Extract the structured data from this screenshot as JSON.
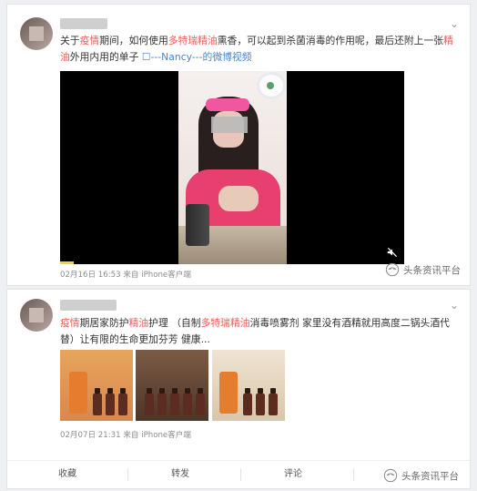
{
  "post1": {
    "text_parts": [
      {
        "t": "关于",
        "hl": false
      },
      {
        "t": "疫情",
        "hl": true
      },
      {
        "t": "期间，如何使用",
        "hl": false
      },
      {
        "t": "多特瑞精油",
        "hl": true
      },
      {
        "t": "熏香，可以起到杀菌消毒的作用呢，最后还附上一张",
        "hl": false
      },
      {
        "t": "精油",
        "hl": true
      },
      {
        "t": "外用内用的单子 ",
        "hl": false
      }
    ],
    "video_link": "☐---Nancy---的微博视频",
    "meta": "02月16日 16:53 来自 iPhone客户端",
    "video_progress": 0.04
  },
  "post2": {
    "text_parts": [
      {
        "t": "疫情",
        "hl": true
      },
      {
        "t": "期居家防护",
        "hl": false
      },
      {
        "t": "精油",
        "hl": true
      },
      {
        "t": "护理 （自制",
        "hl": false
      },
      {
        "t": "多特瑞精油",
        "hl": true
      },
      {
        "t": "消毒喷雾剂 家里没有酒精就用高度二锅头酒代替）让有限的生命更加芬芳 健康...",
        "hl": false
      }
    ],
    "meta": "02月07日 21:31 来自 iPhone客户端",
    "actions": [
      "收藏",
      "转发",
      "评论"
    ]
  },
  "watermark": "头条资讯平台",
  "colors": {
    "highlight": "#eb5b5b",
    "link": "#4c82c8",
    "progress": "#f7d342"
  },
  "icons": {
    "more": "chevron-down-icon",
    "mute": "mute-icon",
    "watermark": "watermark-logo-icon"
  }
}
